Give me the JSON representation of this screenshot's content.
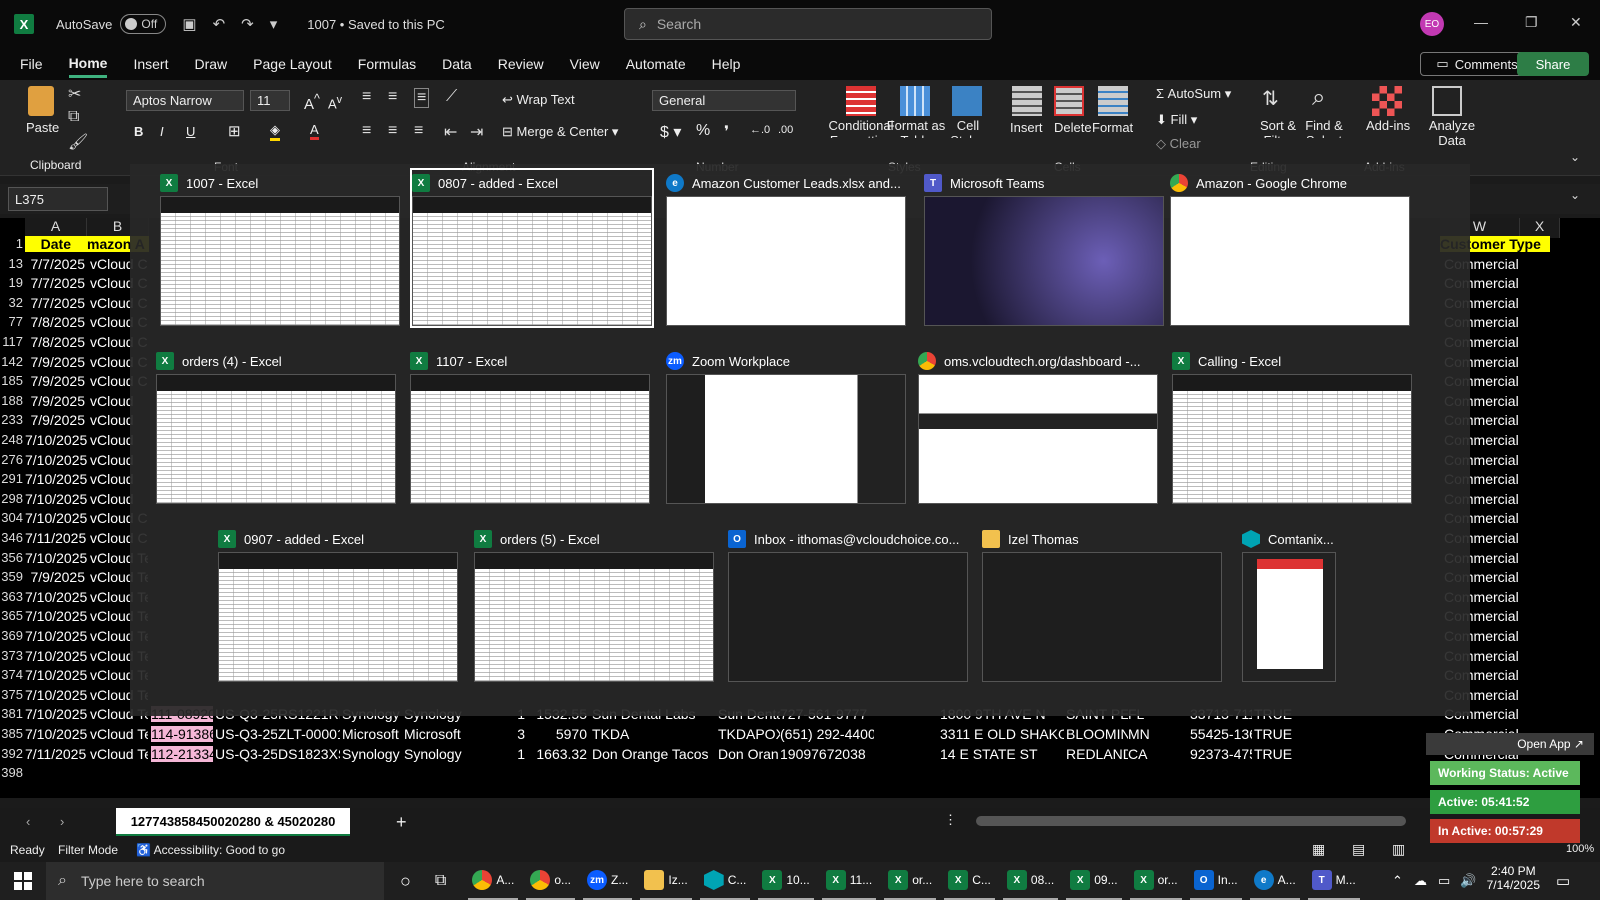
{
  "titlebar": {
    "autosave_label": "AutoSave",
    "autosave_state": "Off",
    "doc_title": "1007 • Saved to this PC",
    "search_placeholder": "Search",
    "avatar_initials": "EO"
  },
  "menu": [
    "File",
    "Home",
    "Insert",
    "Draw",
    "Page Layout",
    "Formulas",
    "Data",
    "Review",
    "View",
    "Automate",
    "Help"
  ],
  "menu_active": "Home",
  "actions": {
    "comments": "Comments",
    "share": "Share"
  },
  "ribbon": {
    "paste": "Paste",
    "clipboard": "Clipboard",
    "font_name": "Aptos Narrow",
    "font_size": "11",
    "font_group": "Font",
    "wrap_text": "Wrap Text",
    "merge_center": "Merge & Center",
    "alignment_group": "Alignment",
    "number_format": "General",
    "number_group": "Number",
    "conditional_formatting": "Conditional Formatting",
    "format_as_table": "Format as Table",
    "cell_styles": "Cell Styles",
    "styles_group": "Styles",
    "insert": "Insert",
    "delete": "Delete",
    "format": "Format",
    "cells_group": "Cells",
    "autosum": "AutoSum",
    "fill": "Fill",
    "clear": "Clear",
    "sort_filter": "Sort & Filter",
    "find_select": "Find & Select",
    "editing_group": "Editing",
    "addins": "Add-ins",
    "addins_group": "Add-ins",
    "analyze_data": "Analyze Data"
  },
  "namebox": "L375",
  "columns": [
    "A",
    "B",
    "W",
    "X"
  ],
  "grid": {
    "header_row": {
      "rownum": "1",
      "a": "Date",
      "b": "mazon A",
      "w": "Customer Type"
    },
    "top_rows": [
      {
        "r": "13",
        "a": "7/7/2025",
        "b": "vCloud Ch",
        "w": "Commercial"
      },
      {
        "r": "19",
        "a": "7/7/2025",
        "b": "vCloud Ch",
        "w": "Commercial"
      },
      {
        "r": "32",
        "a": "7/7/2025",
        "b": "vCloud Ch",
        "w": "Commercial"
      },
      {
        "r": "77",
        "a": "7/8/2025",
        "b": "vCloud Ch",
        "w": "Commercial"
      },
      {
        "r": "117",
        "a": "7/8/2025",
        "b": "vCloud Ch",
        "w": "Commercial"
      },
      {
        "r": "142",
        "a": "7/9/2025",
        "b": "vCloud Ch",
        "w": "Commercial"
      },
      {
        "r": "185",
        "a": "7/9/2025",
        "b": "vCloud Ch",
        "w": "Commercial"
      },
      {
        "r": "188",
        "a": "7/9/2025",
        "b": "vCloud",
        "w": "Commercial"
      },
      {
        "r": "233",
        "a": "7/9/2025",
        "b": "vCloud",
        "w": "Commercial"
      },
      {
        "r": "248",
        "a": "7/10/2025",
        "b": "vCloud",
        "w": "Commercial"
      },
      {
        "r": "276",
        "a": "7/10/2025",
        "b": "vCloud",
        "w": "Commercial"
      },
      {
        "r": "291",
        "a": "7/10/2025",
        "b": "vCloud",
        "w": "Commercial"
      },
      {
        "r": "298",
        "a": "7/10/2025",
        "b": "vCloud",
        "w": "Commercial"
      },
      {
        "r": "304",
        "a": "7/10/2025",
        "b": "vCloud Ch",
        "w": "Commercial"
      },
      {
        "r": "346",
        "a": "7/11/2025",
        "b": "vCloud Ch",
        "w": "Commercial"
      },
      {
        "r": "356",
        "a": "7/10/2025",
        "b": "vCloud Te",
        "w": "Commercial"
      },
      {
        "r": "359",
        "a": "7/9/2025",
        "b": "vCloud Te",
        "w": "Commercial"
      },
      {
        "r": "363",
        "a": "7/10/2025",
        "b": "vCloud Te",
        "w": "Commercial"
      },
      {
        "r": "365",
        "a": "7/10/2025",
        "b": "vCloud Te",
        "w": "Commercial"
      },
      {
        "r": "369",
        "a": "7/10/2025",
        "b": "vCloud Te",
        "w": "Commercial"
      },
      {
        "r": "373",
        "a": "7/10/2025",
        "b": "vCloud Te",
        "w": "Commercial"
      },
      {
        "r": "374",
        "a": "7/10/2025",
        "b": "vCloud Te",
        "w": "Commercial"
      },
      {
        "r": "375",
        "a": "7/10/2025",
        "b": "vCloud Te",
        "w": "Commercial"
      }
    ],
    "bottom_rows": [
      {
        "r": "381",
        "a": "7/10/2025",
        "b": "vCloud Te",
        "c": "111-08920",
        "d": "US-Q3-25-",
        "e": "RS1221RP-",
        "f": "Synology E",
        "g": "Synology",
        "h": "1",
        "i": "1532.55",
        "j": "Sun Dental Labs",
        "k": "Sun Denta",
        "l": "727-561-9777",
        "n": "1800 9TH AVE N",
        "o": "SAINT PET",
        "p": "FL",
        "q": "33713-711",
        "r2": "TRUE",
        "w": "Commercial"
      },
      {
        "r": "385",
        "a": "7/10/2025",
        "b": "vCloud Te",
        "c": "114-91386",
        "d": "US-Q3-25-",
        "e": "ZLT-00001",
        "f": "Microsoft",
        "g": "Microsoft",
        "h": "3",
        "i": "5970",
        "j": "TKDA",
        "k": "TKDAPOX:",
        "l": "(651) 292-4400",
        "n": "3311 E OLD SHAKOPE",
        "o": "BLOOMIN",
        "p": "MN",
        "q": "55425-136",
        "r2": "TRUE",
        "w": "Commercial"
      },
      {
        "r": "392",
        "a": "7/11/2025",
        "b": "vCloud Te",
        "c": "112-21334",
        "d": "US-Q3-25-",
        "e": "DS1823XS-",
        "f": "Synology E",
        "g": "Synology",
        "h": "1",
        "i": "1663.32",
        "j": "Don Orange Tacos",
        "k": "Don Oran",
        "l": "19097672038",
        "n": "14 E STATE ST",
        "o": "REDLANDS",
        "p": "CA",
        "q": "92373-475",
        "r2": "TRUE",
        "w": "Commercial"
      }
    ],
    "empty_row": "398"
  },
  "sheet_tab": "127743858450020280 & 45020280",
  "statusbar": {
    "ready": "Ready",
    "filter_mode": "Filter Mode",
    "accessibility": "Accessibility: Good to go",
    "zoom": "100%"
  },
  "switcher": {
    "windows": [
      {
        "title": "1007 - Excel",
        "app": "excel"
      },
      {
        "title": "0807 - added - Excel",
        "app": "excel"
      },
      {
        "title": "Amazon Customer Leads.xlsx and...",
        "app": "edge"
      },
      {
        "title": "Microsoft Teams",
        "app": "teams"
      },
      {
        "title": "Amazon - Google Chrome",
        "app": "chrome"
      },
      {
        "title": "orders (4) - Excel",
        "app": "excel"
      },
      {
        "title": "1107 - Excel",
        "app": "excel"
      },
      {
        "title": "Zoom Workplace",
        "app": "zoom"
      },
      {
        "title": "oms.vcloudtech.org/dashboard -...",
        "app": "chrome"
      },
      {
        "title": "Calling - Excel",
        "app": "excel"
      },
      {
        "title": "0907 - added - Excel",
        "app": "excel"
      },
      {
        "title": "orders (5) - Excel",
        "app": "excel"
      },
      {
        "title": "Inbox - ithomas@vcloudchoice.co...",
        "app": "outlook"
      },
      {
        "title": "Izel Thomas",
        "app": "folder"
      },
      {
        "title": "Comtanix...",
        "app": "comtanix"
      }
    ]
  },
  "status_widget": {
    "open_app": "Open App ↗",
    "working_status": "Working Status: Active",
    "active": "Active: 05:41:52",
    "inactive": "In Active: 00:57:29",
    "colors": {
      "working": "#5cb85c",
      "active": "#2e9e40",
      "inactive": "#c0392b"
    }
  },
  "taskbar": {
    "search_placeholder": "Type here to search",
    "items": [
      {
        "label": "A...",
        "app": "chrome"
      },
      {
        "label": "o...",
        "app": "chrome"
      },
      {
        "label": "Z...",
        "app": "zoom"
      },
      {
        "label": "Iz...",
        "app": "folder"
      },
      {
        "label": "C...",
        "app": "comtanix"
      },
      {
        "label": "10...",
        "app": "excel"
      },
      {
        "label": "11...",
        "app": "excel"
      },
      {
        "label": "or...",
        "app": "excel"
      },
      {
        "label": "C...",
        "app": "excel"
      },
      {
        "label": "08...",
        "app": "excel"
      },
      {
        "label": "09...",
        "app": "excel"
      },
      {
        "label": "or...",
        "app": "excel"
      },
      {
        "label": "In...",
        "app": "outlook"
      },
      {
        "label": "A...",
        "app": "edge"
      },
      {
        "label": "M...",
        "app": "teams"
      }
    ],
    "time": "2:40 PM",
    "date": "7/14/2025"
  }
}
